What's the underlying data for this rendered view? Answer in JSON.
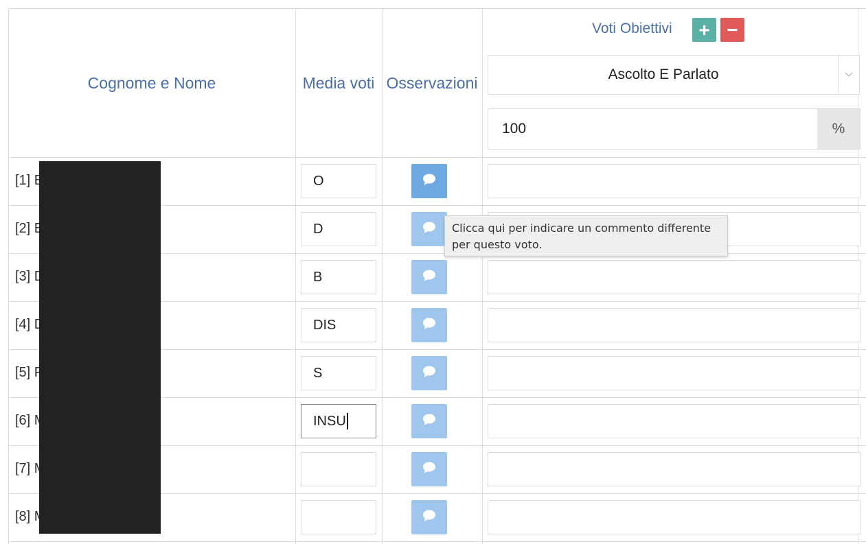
{
  "headers": {
    "name": "Cognome e Nome",
    "media": "Media voti",
    "osservazioni": "Osservazioni",
    "voti_obiettivi": "Voti Obiettivi"
  },
  "buttons": {
    "add": "+",
    "remove": "−"
  },
  "objective_select": {
    "selected": "Ascolto E Parlato"
  },
  "percent": {
    "value": "100",
    "unit": "%"
  },
  "rows": [
    {
      "label": "[1] E",
      "media": "O"
    },
    {
      "label": "[2] E",
      "media": "D"
    },
    {
      "label": "[3] D",
      "media": "B"
    },
    {
      "label": "[4] D",
      "media": "DIS"
    },
    {
      "label": "[5] F",
      "media": "S"
    },
    {
      "label": "[6] M",
      "media": "INSU"
    },
    {
      "label": "[7] M",
      "media": ""
    },
    {
      "label": "[8] M",
      "media": ""
    }
  ],
  "tooltip": {
    "line1": "Clicca qui per indicare un commento differente",
    "line2": "per questo voto."
  },
  "colors": {
    "header_text": "#4a6ea8",
    "add_button": "#5cb1a6",
    "remove_button": "#e05a5a",
    "comment_button": "#9fc7ee",
    "comment_button_hover": "#6ea9e4"
  },
  "icons": {
    "comment": "speech-bubble-icon",
    "dropdown": "chevron-down-icon"
  }
}
